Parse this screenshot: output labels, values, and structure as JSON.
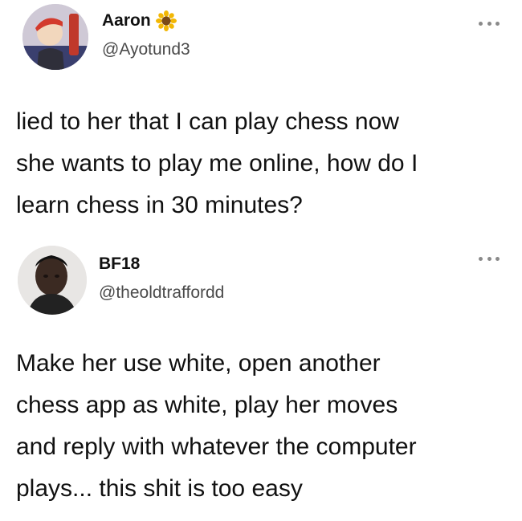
{
  "tweets": [
    {
      "display_name": "Aaron",
      "name_emoji": "sunflower-emoji",
      "handle": "@Ayotund3",
      "avatar": "avatar-icon",
      "more_icon": "more-options-icon",
      "lines": [
        "lied to her that I can play chess now",
        "she wants to play me online, how do I",
        "learn chess in 30 minutes?"
      ]
    },
    {
      "display_name": "BF18",
      "handle": "@theoldtraffordd",
      "avatar": "avatar-icon",
      "more_icon": "more-options-icon",
      "lines": [
        "Make her use white, open another",
        "chess app as white, play her moves",
        "and reply with whatever the computer",
        "plays... this shit is too easy"
      ]
    }
  ],
  "colors": {
    "text": "#111111",
    "handle": "#4a4a4a",
    "more_dots": "#8a8a8a",
    "background": "#ffffff"
  }
}
